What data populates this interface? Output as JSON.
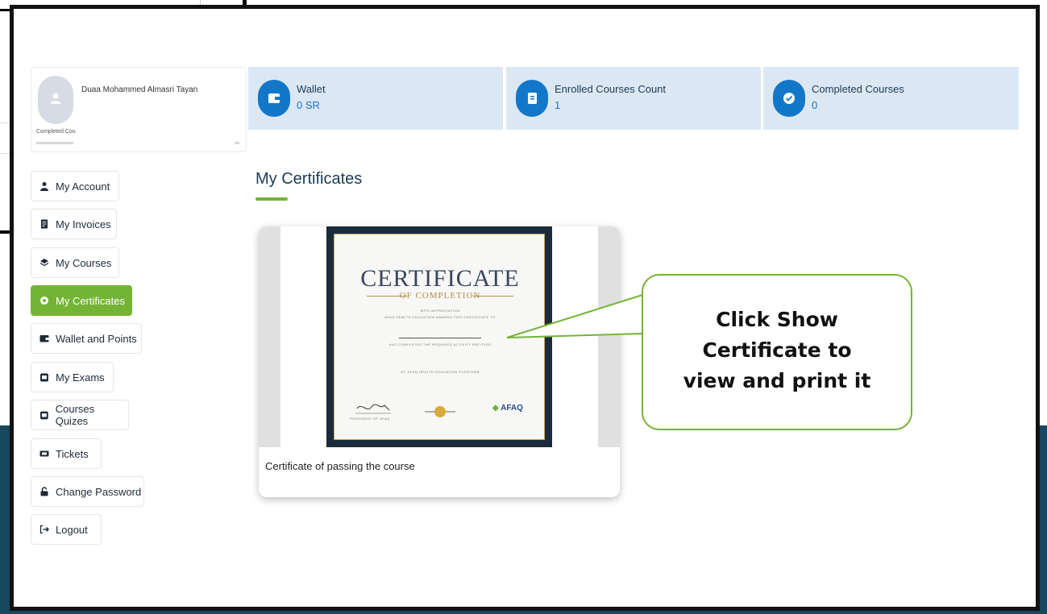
{
  "profile": {
    "name": "Duaa Mohammed Almasri Tayan",
    "completed_label": "Completed Cou"
  },
  "stats": [
    {
      "label": "Wallet",
      "value": "0 SR",
      "icon": "wallet-icon"
    },
    {
      "label": "Enrolled Courses Count",
      "value": "1",
      "icon": "book-icon"
    },
    {
      "label": "Completed Courses",
      "value": "0",
      "icon": "check-circle-icon"
    }
  ],
  "menu": [
    {
      "label": "My Account",
      "icon": "user-icon"
    },
    {
      "label": "My Invoices",
      "icon": "invoice-icon"
    },
    {
      "label": "My Courses",
      "icon": "layers-icon"
    },
    {
      "label": "My Certificates",
      "icon": "certificate-icon",
      "active": true
    },
    {
      "label": "Wallet and Points",
      "icon": "wallet-icon"
    },
    {
      "label": "My Exams",
      "icon": "exam-icon"
    },
    {
      "label": "Courses Quizes",
      "icon": "quiz-icon"
    },
    {
      "label": "Tickets",
      "icon": "ticket-icon"
    },
    {
      "label": "Change Password",
      "icon": "lock-icon"
    },
    {
      "label": "Logout",
      "icon": "logout-icon"
    }
  ],
  "section_title": "My Certificates",
  "certificate": {
    "heading": "CERTIFICATE",
    "subheading": "OF COMPLETION",
    "line1": "WITH APPRECIATION",
    "line2": "AFAQ HEALTH EDUCATION AWARDS THIS CERTIFICATE TO",
    "line3": "HAS COMPLETED THE REQUIRED ACTIVITY ENTITLED",
    "line4": "AT: AFAQ HEALTH EDUCATION PLATFORM",
    "signer": "PRESIDENT OF AFAQ",
    "logo": "AFAQ",
    "caption": "Certificate of passing the course"
  },
  "callout": {
    "line1": "Click Show",
    "line2": "Certificate to",
    "line3": "view and print it"
  },
  "colors": {
    "accent_green": "#74b435",
    "stat_bg": "#dbe8f4",
    "icon_blue": "#1377c9",
    "footer_band": "#17485f"
  }
}
